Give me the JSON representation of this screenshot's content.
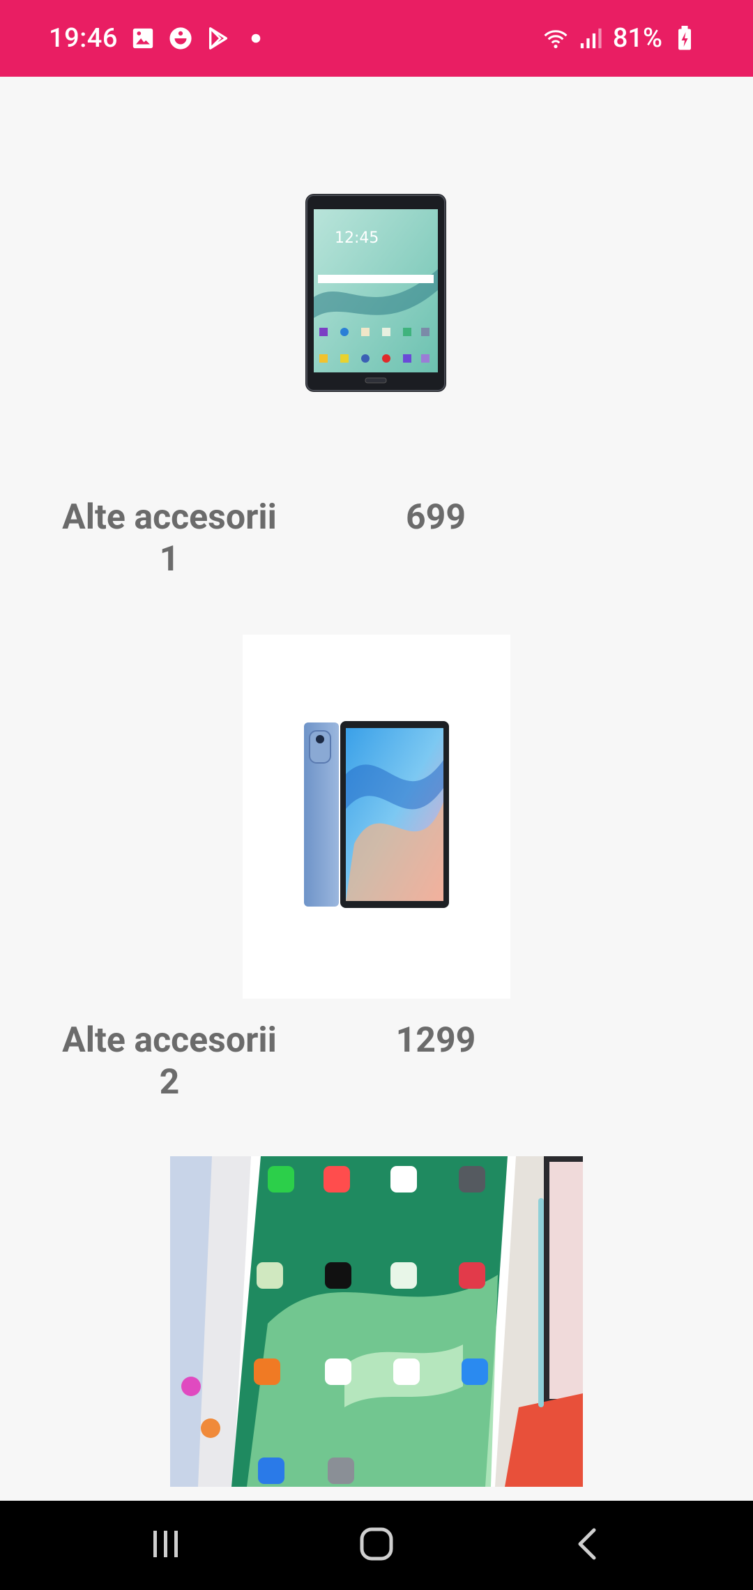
{
  "status_bar": {
    "time": "19:46",
    "battery_percent": "81%",
    "notification_icons": [
      "gallery-icon",
      "face-icon",
      "play-store-icon",
      "dot-icon"
    ],
    "system_icons": [
      "wifi-icon",
      "signal-icon",
      "battery-charging-icon"
    ],
    "background_color": "#e91e63"
  },
  "products": [
    {
      "name": "Alte accesorii 1",
      "price": "699",
      "image": "samsung-tablet-image"
    },
    {
      "name": "Alte accesorii 2",
      "price": "1299",
      "image": "blue-tablet-image"
    },
    {
      "name": "",
      "price": "",
      "image": "ipad-collage-image"
    }
  ],
  "nav_bar": {
    "buttons": [
      "recents-icon",
      "home-icon",
      "back-icon"
    ]
  }
}
